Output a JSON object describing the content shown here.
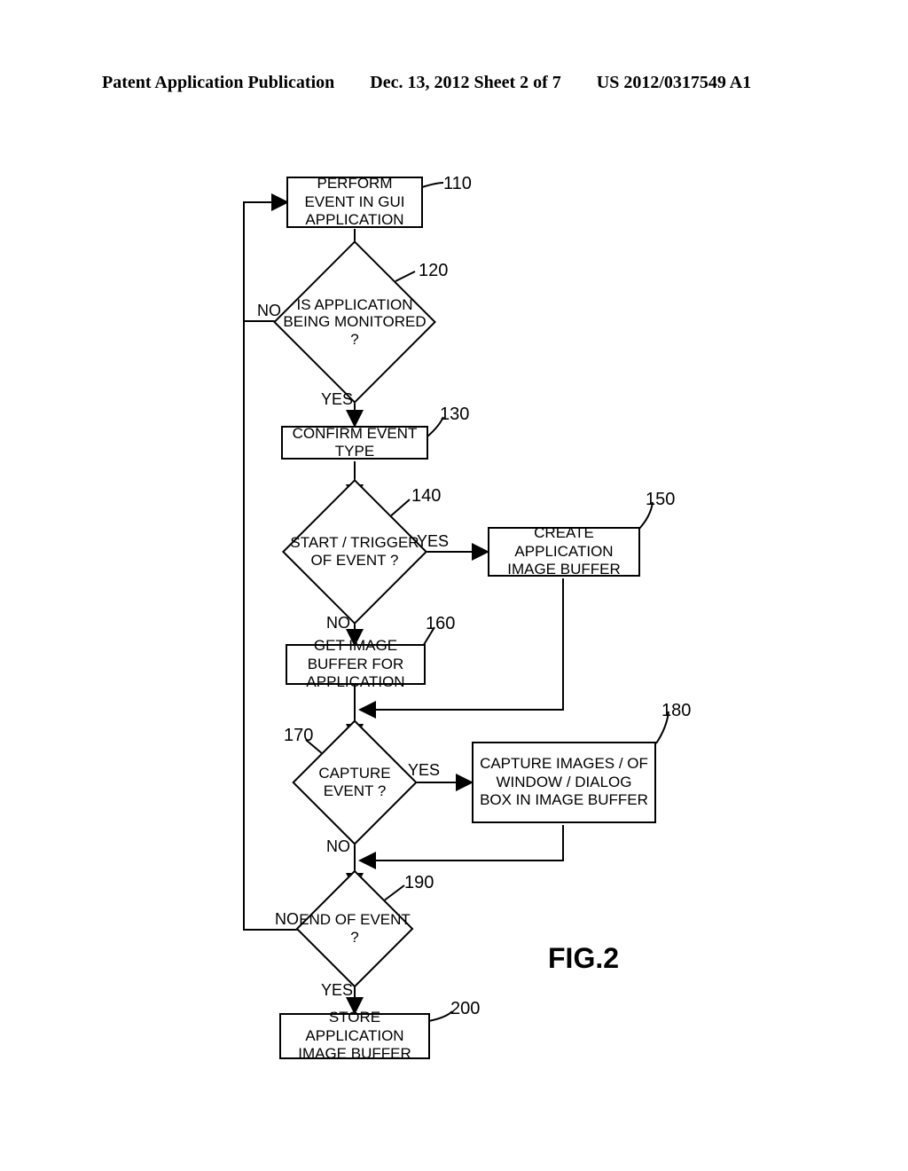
{
  "header": {
    "left": "Patent Application Publication",
    "mid": "Dec. 13, 2012  Sheet 2 of 7",
    "right": "US 2012/0317549 A1"
  },
  "figure_label": "FIG.2",
  "nodes": {
    "n110": "PERFORM EVENT IN GUI APPLICATION",
    "n120": "IS APPLICATION BEING MONITORED ?",
    "n130": "CONFIRM EVENT TYPE",
    "n140": "START / TRIGGER OF EVENT ?",
    "n150": "CREATE APPLICATION IMAGE BUFFER",
    "n160": "GET IMAGE BUFFER FOR APPLICATION",
    "n170": "CAPTURE EVENT ?",
    "n180": "CAPTURE IMAGES / OF WINDOW / DIALOG BOX IN IMAGE BUFFER",
    "n190": "END OF EVENT ?",
    "n200": "STORE APPLICATION IMAGE BUFFER"
  },
  "numbers": {
    "r110": "110",
    "r120": "120",
    "r130": "130",
    "r140": "140",
    "r150": "150",
    "r160": "160",
    "r170": "170",
    "r180": "180",
    "r190": "190",
    "r200": "200"
  },
  "labels": {
    "yes": "YES",
    "no": "NO"
  },
  "chart_data": {
    "type": "flowchart",
    "title": "FIG.2",
    "nodes": [
      {
        "id": "110",
        "type": "process",
        "text": "PERFORM EVENT IN GUI APPLICATION"
      },
      {
        "id": "120",
        "type": "decision",
        "text": "IS APPLICATION BEING MONITORED ?"
      },
      {
        "id": "130",
        "type": "process",
        "text": "CONFIRM EVENT TYPE"
      },
      {
        "id": "140",
        "type": "decision",
        "text": "START / TRIGGER OF EVENT ?"
      },
      {
        "id": "150",
        "type": "process",
        "text": "CREATE APPLICATION IMAGE BUFFER"
      },
      {
        "id": "160",
        "type": "process",
        "text": "GET IMAGE BUFFER FOR APPLICATION"
      },
      {
        "id": "170",
        "type": "decision",
        "text": "CAPTURE EVENT ?"
      },
      {
        "id": "180",
        "type": "process",
        "text": "CAPTURE IMAGES / OF WINDOW / DIALOG BOX IN IMAGE BUFFER"
      },
      {
        "id": "190",
        "type": "decision",
        "text": "END OF EVENT ?"
      },
      {
        "id": "200",
        "type": "process",
        "text": "STORE APPLICATION IMAGE BUFFER"
      }
    ],
    "edges": [
      {
        "from": "110",
        "to": "120"
      },
      {
        "from": "120",
        "to": "110",
        "label": "NO"
      },
      {
        "from": "120",
        "to": "130",
        "label": "YES"
      },
      {
        "from": "130",
        "to": "140"
      },
      {
        "from": "140",
        "to": "150",
        "label": "YES"
      },
      {
        "from": "140",
        "to": "160",
        "label": "NO"
      },
      {
        "from": "150",
        "to": "170"
      },
      {
        "from": "160",
        "to": "170"
      },
      {
        "from": "170",
        "to": "180",
        "label": "YES"
      },
      {
        "from": "170",
        "to": "190",
        "label": "NO"
      },
      {
        "from": "180",
        "to": "190"
      },
      {
        "from": "190",
        "to": "110",
        "label": "NO"
      },
      {
        "from": "190",
        "to": "200",
        "label": "YES"
      }
    ]
  }
}
